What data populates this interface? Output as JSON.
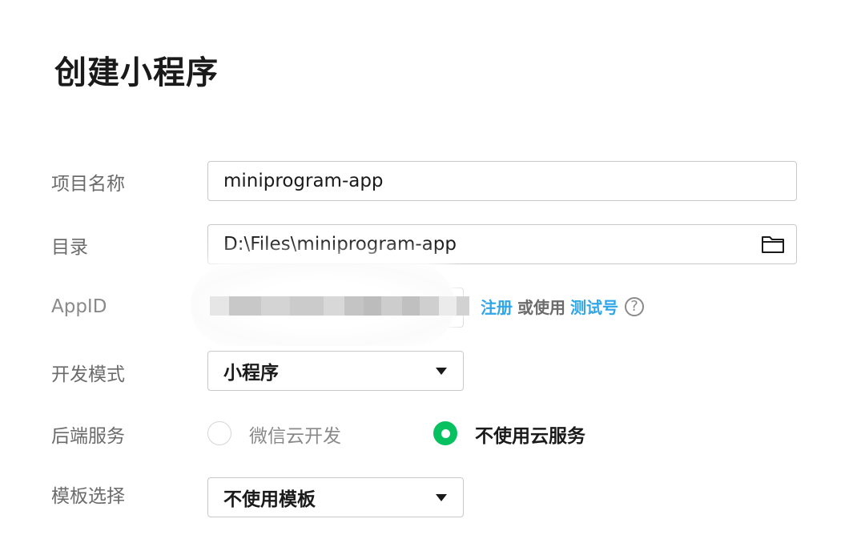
{
  "page": {
    "title": "创建小程序"
  },
  "form": {
    "project_name": {
      "label": "项目名称",
      "value": "miniprogram-app"
    },
    "directory": {
      "label": "目录",
      "value": "D:\\Files\\miniprogram-app",
      "icon": "folder-icon"
    },
    "appid": {
      "label": "AppID",
      "value": "",
      "register_link": "注册",
      "or_use_text": "或使用",
      "test_account_link": "测试号",
      "help_icon": "question-circle-icon",
      "help_glyph": "?"
    },
    "dev_mode": {
      "label": "开发模式",
      "selected": "小程序"
    },
    "backend": {
      "label": "后端服务",
      "options": [
        {
          "label": "微信云开发",
          "selected": false
        },
        {
          "label": "不使用云服务",
          "selected": true
        }
      ]
    },
    "template": {
      "label": "模板选择",
      "selected": "不使用模板"
    }
  },
  "colors": {
    "link": "#2fa6e8",
    "radio_active": "#07c160",
    "label": "#6b6b6b"
  }
}
